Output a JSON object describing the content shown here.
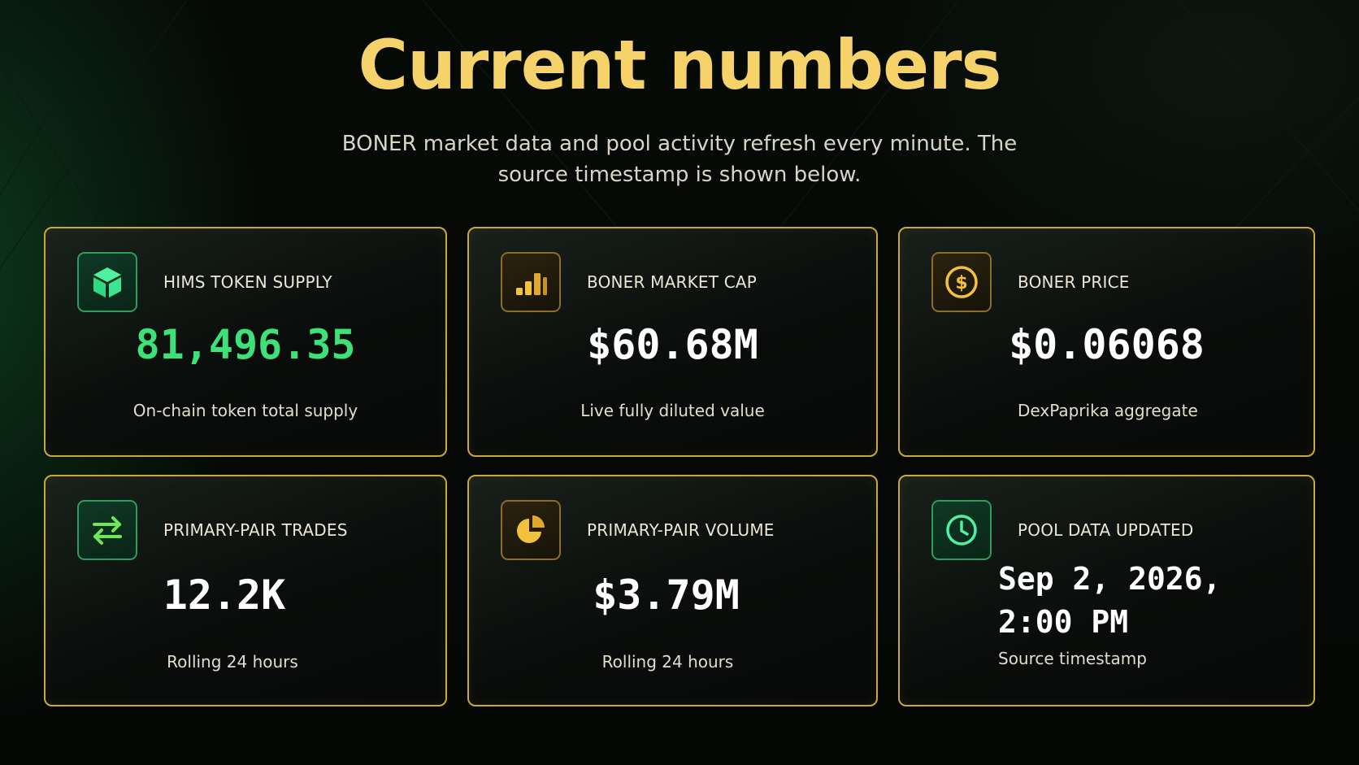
{
  "header": {
    "title": "Current numbers",
    "subtitle": "BONER market data and pool activity refresh every minute. The source timestamp is shown below."
  },
  "colors": {
    "accent_gold": "#f6d36a",
    "card_border": "#c9a83a",
    "positive_green": "#3ee07a",
    "background": "#050706"
  },
  "cards": [
    {
      "icon": "cube-icon",
      "label": "HIMS TOKEN SUPPLY",
      "value": "81,496.35",
      "caption": "On-chain token total supply"
    },
    {
      "icon": "bar-chart-icon",
      "label": "BONER MARKET CAP",
      "value": "$60.68M",
      "caption": "Live fully diluted value"
    },
    {
      "icon": "dollar-coin-icon",
      "label": "BONER PRICE",
      "value": "$0.06068",
      "caption": "DexPaprika aggregate"
    },
    {
      "icon": "swap-arrows-icon",
      "label": "PRIMARY-PAIR TRADES",
      "value": "12.2K",
      "caption": "Rolling 24 hours"
    },
    {
      "icon": "pie-chart-icon",
      "label": "PRIMARY-PAIR VOLUME",
      "value": "$3.79M",
      "caption": "Rolling 24 hours"
    },
    {
      "icon": "clock-icon",
      "label": "POOL DATA UPDATED",
      "value": "Sep 2, 2026, 2:00 PM",
      "caption": "Source timestamp"
    }
  ]
}
